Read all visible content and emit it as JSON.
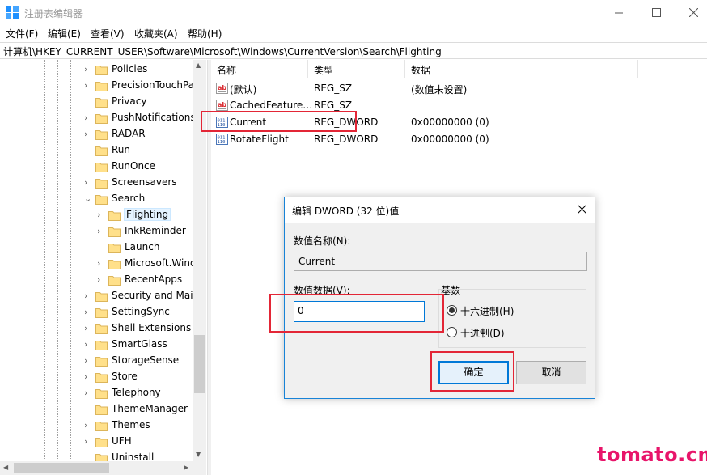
{
  "window": {
    "title": "注册表编辑器",
    "icon": "registry-editor-icon"
  },
  "menu": [
    "文件(F)",
    "编辑(E)",
    "查看(V)",
    "收藏夹(A)",
    "帮助(H)"
  ],
  "address": "计算机\\HKEY_CURRENT_USER\\Software\\Microsoft\\Windows\\CurrentVersion\\Search\\Flighting",
  "tree": {
    "items": [
      {
        "label": "Policies",
        "expander": "›"
      },
      {
        "label": "PrecisionTouchPa",
        "expander": "›"
      },
      {
        "label": "Privacy",
        "expander": ""
      },
      {
        "label": "PushNotifications",
        "expander": "›"
      },
      {
        "label": "RADAR",
        "expander": "›"
      },
      {
        "label": "Run",
        "expander": ""
      },
      {
        "label": "RunOnce",
        "expander": ""
      },
      {
        "label": "Screensavers",
        "expander": "›"
      },
      {
        "label": "Search",
        "expander": "⌄"
      },
      {
        "label": "Flighting",
        "expander": "›"
      },
      {
        "label": "InkReminder",
        "expander": "›"
      },
      {
        "label": "Launch",
        "expander": ""
      },
      {
        "label": "Microsoft.Wind",
        "expander": "›"
      },
      {
        "label": "RecentApps",
        "expander": "›"
      },
      {
        "label": "Security and Main",
        "expander": "›"
      },
      {
        "label": "SettingSync",
        "expander": "›"
      },
      {
        "label": "Shell Extensions",
        "expander": "›"
      },
      {
        "label": "SmartGlass",
        "expander": "›"
      },
      {
        "label": "StorageSense",
        "expander": "›"
      },
      {
        "label": "Store",
        "expander": "›"
      },
      {
        "label": "Telephony",
        "expander": "›"
      },
      {
        "label": "ThemeManager",
        "expander": ""
      },
      {
        "label": "Themes",
        "expander": "›"
      },
      {
        "label": "UFH",
        "expander": "›"
      },
      {
        "label": "Uninstall",
        "expander": ""
      }
    ]
  },
  "list": {
    "columns": [
      "名称",
      "类型",
      "数据"
    ],
    "rows": [
      {
        "name": "(默认)",
        "type": "REG_SZ",
        "data": "(数值未设置)",
        "icon": "string-value-icon"
      },
      {
        "name": "CachedFeature…",
        "type": "REG_SZ",
        "data": "",
        "icon": "string-value-icon"
      },
      {
        "name": "Current",
        "type": "REG_DWORD",
        "data": "0x00000000 (0)",
        "icon": "binary-value-icon"
      },
      {
        "name": "RotateFlight",
        "type": "REG_DWORD",
        "data": "0x00000000 (0)",
        "icon": "binary-value-icon"
      }
    ]
  },
  "dialog": {
    "title": "编辑 DWORD (32 位)值",
    "name_label": "数值名称(N):",
    "name_value": "Current",
    "data_label": "数值数据(V):",
    "data_value": "0",
    "base_label": "基数",
    "radio_hex": "十六进制(H)",
    "radio_dec": "十进制(D)",
    "selected_base": "hex",
    "ok_label": "确定",
    "cancel_label": "取消"
  },
  "watermark": "tomato.cm",
  "colors": {
    "annotation": "#e32636",
    "watermark": "#e8156a",
    "dialog_border": "#1883d7"
  }
}
